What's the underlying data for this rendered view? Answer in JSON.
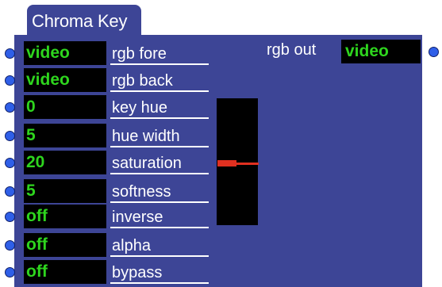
{
  "window": {
    "title": "Chroma Key"
  },
  "inputs": [
    {
      "value": "video",
      "label": "rgb fore"
    },
    {
      "value": "video",
      "label": "rgb back"
    },
    {
      "value": "0",
      "label": "key hue"
    },
    {
      "value": "5",
      "label": "hue width"
    },
    {
      "value": "20",
      "label": "saturation"
    },
    {
      "value": "5",
      "label": "softness"
    },
    {
      "value": "off",
      "label": "inverse"
    },
    {
      "value": "off",
      "label": "alpha"
    },
    {
      "value": "off",
      "label": "bypass"
    }
  ],
  "output": {
    "label": "rgb out",
    "value": "video"
  },
  "slider": {
    "name": "saturation-fader",
    "level": 0.5
  },
  "colors": {
    "panel": "#3d4596",
    "value_text": "#2ed51e",
    "port": "#2f5fe8",
    "slider_handle": "#e03020"
  }
}
